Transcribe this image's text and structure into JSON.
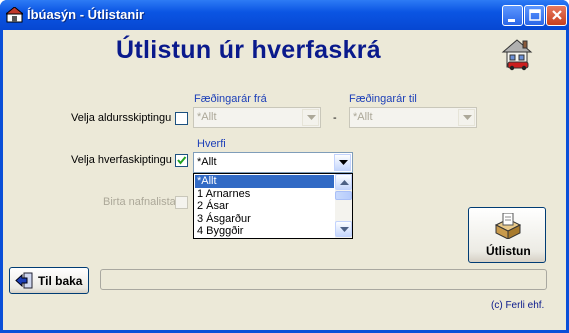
{
  "window": {
    "title": "Íbúasýn - Útlistanir"
  },
  "heading": "Útlistun úr hverfaskrá",
  "age": {
    "checkbox_label": "Velja aldursskiptingu",
    "from_label": "Fæðingarár frá",
    "from_value": "*Allt",
    "dash": "-",
    "to_label": "Fæðingarár til",
    "to_value": "*Allt"
  },
  "district": {
    "checkbox_label": "Velja hverfaskiptingu",
    "label": "Hverfi",
    "value": "*Allt",
    "options": [
      "*Allt",
      "1 Arnarnes",
      "2 Ásar",
      "3 Ásgarður",
      "4 Byggðir"
    ],
    "selected_index": 0
  },
  "names": {
    "checkbox_label": "Birta nafnalista"
  },
  "buttons": {
    "back": "Til baka",
    "list": "Útlistun"
  },
  "footer": {
    "copyright": "(c) Ferli ehf."
  }
}
